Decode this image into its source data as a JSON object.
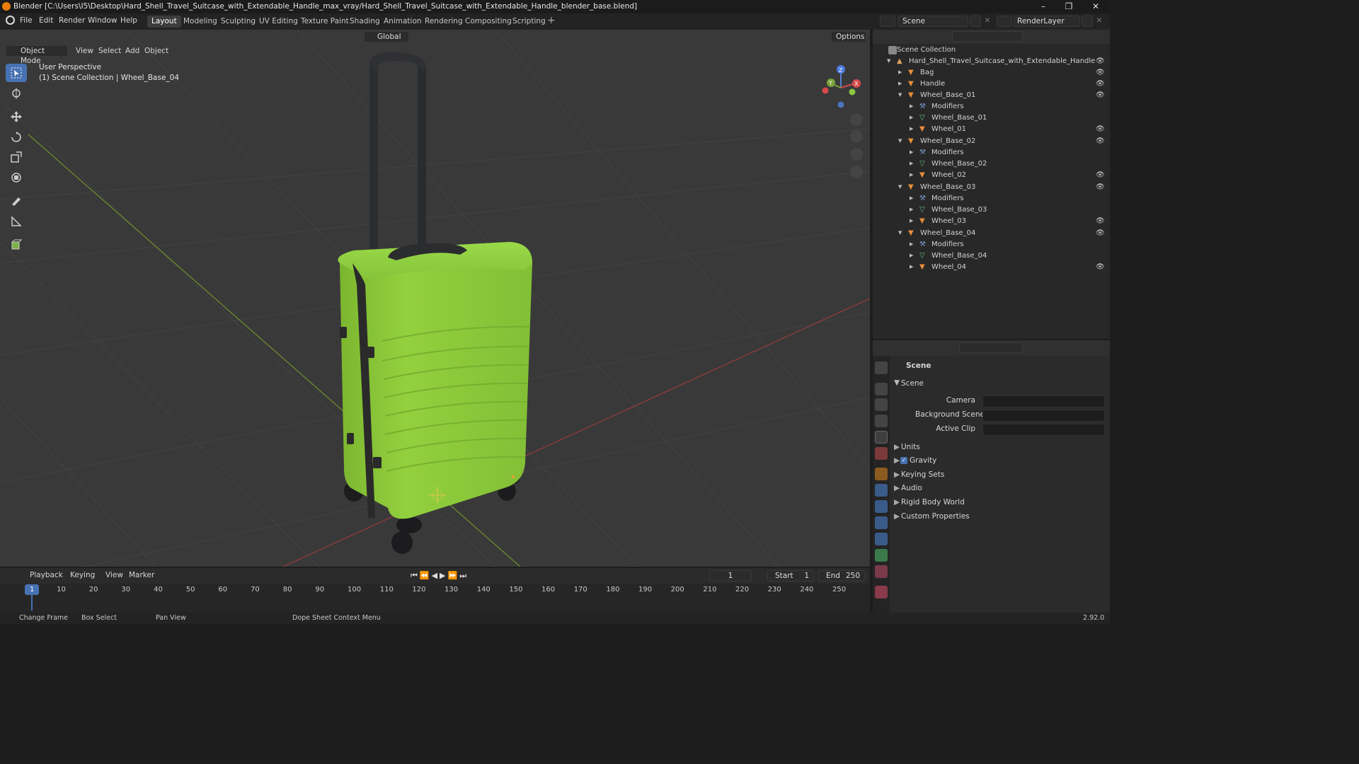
{
  "window": {
    "title": "Blender [C:\\Users\\I5\\Desktop\\Hard_Shell_Travel_Suitcase_with_Extendable_Handle_max_vray/Hard_Shell_Travel_Suitcase_with_Extendable_Handle_blender_base.blend]"
  },
  "menubar": {
    "items": [
      "File",
      "Edit",
      "Render",
      "Window",
      "Help"
    ],
    "workspaces": [
      "Layout",
      "Modeling",
      "Sculpting",
      "UV Editing",
      "Texture Paint",
      "Shading",
      "Animation",
      "Rendering",
      "Compositing",
      "Scripting"
    ],
    "scene": "Scene",
    "view_layer": "RenderLayer"
  },
  "viewport": {
    "mode": "Object Mode",
    "menus": [
      "View",
      "Select",
      "Add",
      "Object"
    ],
    "orientation": "Global",
    "options": "Options",
    "overlay_line1": "User Perspective",
    "overlay_line2": "(1) Scene Collection | Wheel_Base_04",
    "accent": "#4772b3",
    "suitcase_color": "#8ccc3a"
  },
  "outliner": {
    "root": "Scene Collection",
    "collection": "Hard_Shell_Travel_Suitcase_with_Extendable_Handle",
    "objects": [
      "Bag",
      "Handle"
    ],
    "groups": [
      {
        "name": "Wheel_Base_01",
        "children": [
          "Modifiers",
          "Wheel_Base_01",
          "Wheel_01"
        ]
      },
      {
        "name": "Wheel_Base_02",
        "children": [
          "Modifiers",
          "Wheel_Base_02",
          "Wheel_02"
        ]
      },
      {
        "name": "Wheel_Base_03",
        "children": [
          "Modifiers",
          "Wheel_Base_03",
          "Wheel_03"
        ]
      },
      {
        "name": "Wheel_Base_04",
        "children": [
          "Modifiers",
          "Wheel_Base_04",
          "Wheel_04"
        ]
      }
    ]
  },
  "properties": {
    "context": "Scene",
    "section": "Scene",
    "fields": [
      {
        "label": "Camera"
      },
      {
        "label": "Background Scene"
      },
      {
        "label": "Active Clip"
      }
    ],
    "panels": [
      "Units",
      "Gravity",
      "Keying Sets",
      "Audio",
      "Rigid Body World",
      "Custom Properties"
    ],
    "gravity_checked": true
  },
  "timeline": {
    "menus": [
      "Playback",
      "Keying",
      "View",
      "Marker"
    ],
    "current_frame": "1",
    "start_label": "Start",
    "start": "1",
    "end_label": "End",
    "end": "250",
    "ticks": [
      "1",
      "10",
      "20",
      "30",
      "40",
      "50",
      "60",
      "70",
      "80",
      "90",
      "100",
      "110",
      "120",
      "130",
      "140",
      "150",
      "160",
      "170",
      "180",
      "190",
      "200",
      "210",
      "220",
      "230",
      "240",
      "250"
    ]
  },
  "statusbar": {
    "items": [
      "Change Frame",
      "Box Select",
      "Pan View",
      "Dope Sheet Context Menu"
    ],
    "version": "2.92.0"
  }
}
